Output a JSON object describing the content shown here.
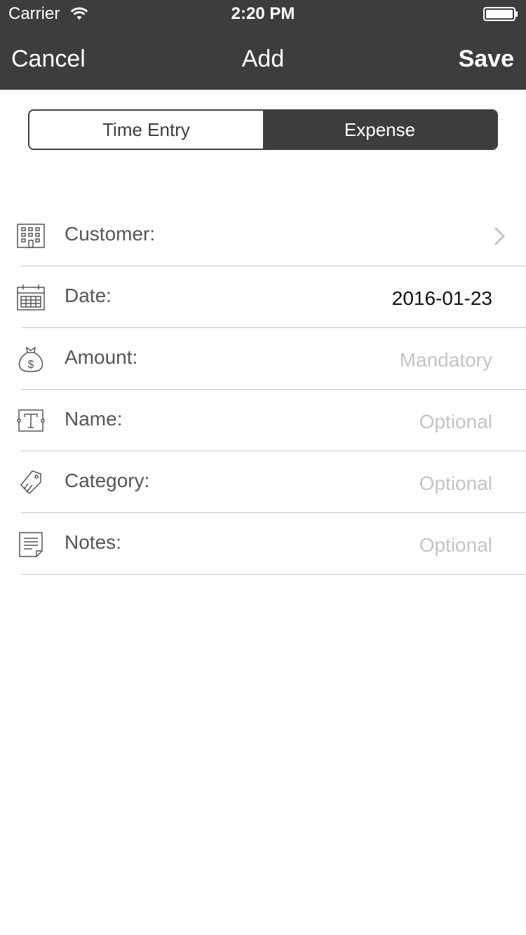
{
  "status_bar": {
    "carrier": "Carrier",
    "time": "2:20 PM"
  },
  "nav": {
    "cancel_label": "Cancel",
    "title": "Add",
    "save_label": "Save"
  },
  "segments": {
    "time_entry": "Time Entry",
    "expense": "Expense",
    "selected": "Expense"
  },
  "form": {
    "customer": {
      "label": "Customer:",
      "icon": "building-icon"
    },
    "date": {
      "label": "Date:",
      "value": "2016-01-23",
      "icon": "calendar-icon"
    },
    "amount": {
      "label": "Amount:",
      "placeholder": "Mandatory",
      "icon": "money-bag-icon"
    },
    "name": {
      "label": "Name:",
      "placeholder": "Optional",
      "icon": "text-icon"
    },
    "category": {
      "label": "Category:",
      "placeholder": "Optional",
      "icon": "tag-icon"
    },
    "notes": {
      "label": "Notes:",
      "placeholder": "Optional",
      "icon": "note-icon"
    }
  },
  "colors": {
    "header_bg": "#3d3d3d",
    "placeholder": "#c4c4c8",
    "divider": "#c8c8cc"
  }
}
